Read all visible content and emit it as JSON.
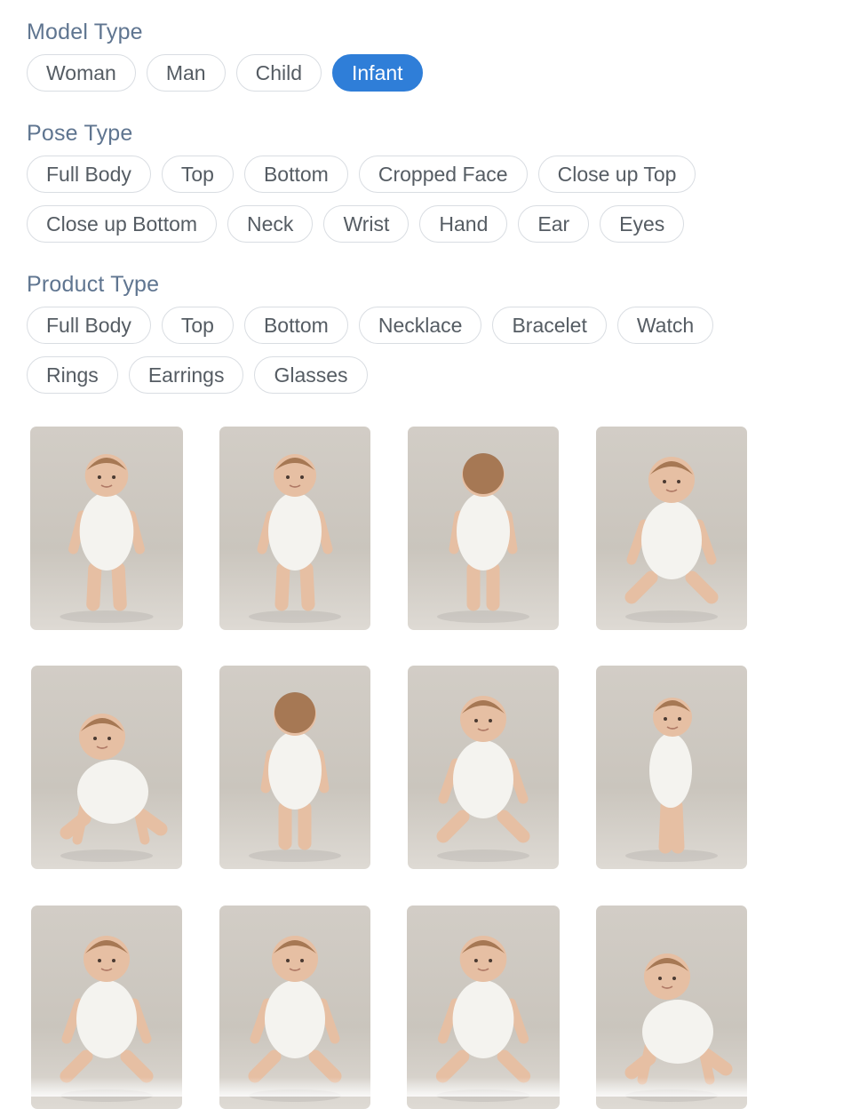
{
  "filters": {
    "model_type": {
      "title": "Model Type",
      "options": [
        "Woman",
        "Man",
        "Child",
        "Infant"
      ],
      "selected": "Infant"
    },
    "pose_type": {
      "title": "Pose Type",
      "options": [
        "Full Body",
        "Top",
        "Bottom",
        "Cropped Face",
        "Close up Top",
        "Close up Bottom",
        "Neck",
        "Wrist",
        "Hand",
        "Ear",
        "Eyes"
      ]
    },
    "product_type": {
      "title": "Product Type",
      "options": [
        "Full Body",
        "Top",
        "Bottom",
        "Necklace",
        "Bracelet",
        "Watch",
        "Rings",
        "Earrings",
        "Glasses"
      ]
    }
  },
  "gallery": {
    "items": [
      {
        "subject": "infant-standing-front"
      },
      {
        "subject": "infant-standing-three-quarter"
      },
      {
        "subject": "infant-standing-back"
      },
      {
        "subject": "infant-sitting-front"
      },
      {
        "subject": "infant-crawling-front"
      },
      {
        "subject": "infant-sitting-back"
      },
      {
        "subject": "infant-sitting-reaching"
      },
      {
        "subject": "infant-standing-side"
      },
      {
        "subject": "infant-sitting-front"
      },
      {
        "subject": "infant-sitting-looking-up"
      },
      {
        "subject": "infant-sitting-looking-up"
      },
      {
        "subject": "infant-crawling-side"
      }
    ]
  },
  "colors": {
    "accent": "#2f7ed8",
    "section_title": "#5f7590",
    "chip_border": "#d9dde2",
    "chip_text": "#555c63",
    "photo_background": "#cdc8c1",
    "onesie": "#f4f3ef",
    "skin": "#e6bfa3",
    "hair": "#9a6b47"
  }
}
